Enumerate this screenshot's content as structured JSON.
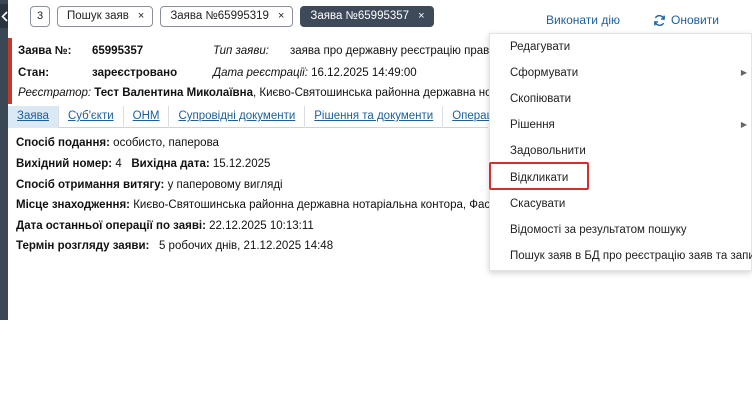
{
  "tabs": {
    "count": "3",
    "items": [
      {
        "label": "Пошук заяв",
        "active": false
      },
      {
        "label": "Заява №65995319",
        "active": false
      },
      {
        "label": "Заява №65995357",
        "active": true
      }
    ],
    "close_glyph": "×"
  },
  "actions": {
    "execute_label": "Виконати дію",
    "refresh_label": "Оновити"
  },
  "header": {
    "app_no_label": "Заява №:",
    "app_no_value": "65995357",
    "type_label": "Тип заяви:",
    "type_value": "заява про державну реєстрацію прав",
    "state_label": "Стан:",
    "state_value": "зареєстровано",
    "reg_date_label": "Дата реєстрації:",
    "reg_date_value": "16.12.2025 14:49:00",
    "registrar_label": "Реєстратор:",
    "registrar_name": "Тест Валентина Миколаївна",
    "registrar_org": ", Києво-Святошинська районна державна нотаріальна контора"
  },
  "content_tabs": [
    {
      "label": "Заява",
      "active": true
    },
    {
      "label": "Суб'єкти",
      "active": false
    },
    {
      "label": "ОНМ",
      "active": false
    },
    {
      "label": "Супровідні документи",
      "active": false
    },
    {
      "label": "Рішення та документи",
      "active": false
    },
    {
      "label": "Операції",
      "active": false
    }
  ],
  "details": {
    "submission_label": "Спосіб подання:",
    "submission_value": "особисто, паперова",
    "out_no_label": "Вихідний номер:",
    "out_no_value": "4",
    "out_date_label": "Вихідна дата:",
    "out_date_value": "15.12.2025",
    "extract_label": "Спосіб отримання витягу:",
    "extract_value": "у паперовому вигляді",
    "location_label": "Місце знаходження:",
    "location_value": "Києво-Святошинська районна державна нотаріальна контора, Фастівський",
    "last_op_label": "Дата останньої операції по заяві:",
    "last_op_value": "22.12.2025 10:13:11",
    "review_label": "Термін розгляду заяви:",
    "review_value": "5 робочих днів, 21.12.2025 14:48"
  },
  "menu": {
    "items": [
      {
        "label": "Редагувати",
        "submenu": false
      },
      {
        "label": "Сформувати",
        "submenu": true
      },
      {
        "label": "Скопіювати",
        "submenu": false
      },
      {
        "label": "Рішення",
        "submenu": true
      },
      {
        "label": "Задовольнити",
        "submenu": false
      },
      {
        "label": "Відкликати",
        "submenu": false,
        "highlighted": true
      },
      {
        "label": "Скасувати",
        "submenu": false
      },
      {
        "label": "Відомості за результатом пошуку",
        "submenu": false
      },
      {
        "label": "Пошук заяв в БД про реєстрацію заяв та запитів",
        "submenu": false
      }
    ],
    "arrow_glyph": "▶"
  },
  "colors": {
    "accent_link": "#1b5f9b",
    "active_tab_bg": "#3e4a5a",
    "highlight_border": "#d42f2f",
    "header_stripe": "#c0392b"
  }
}
